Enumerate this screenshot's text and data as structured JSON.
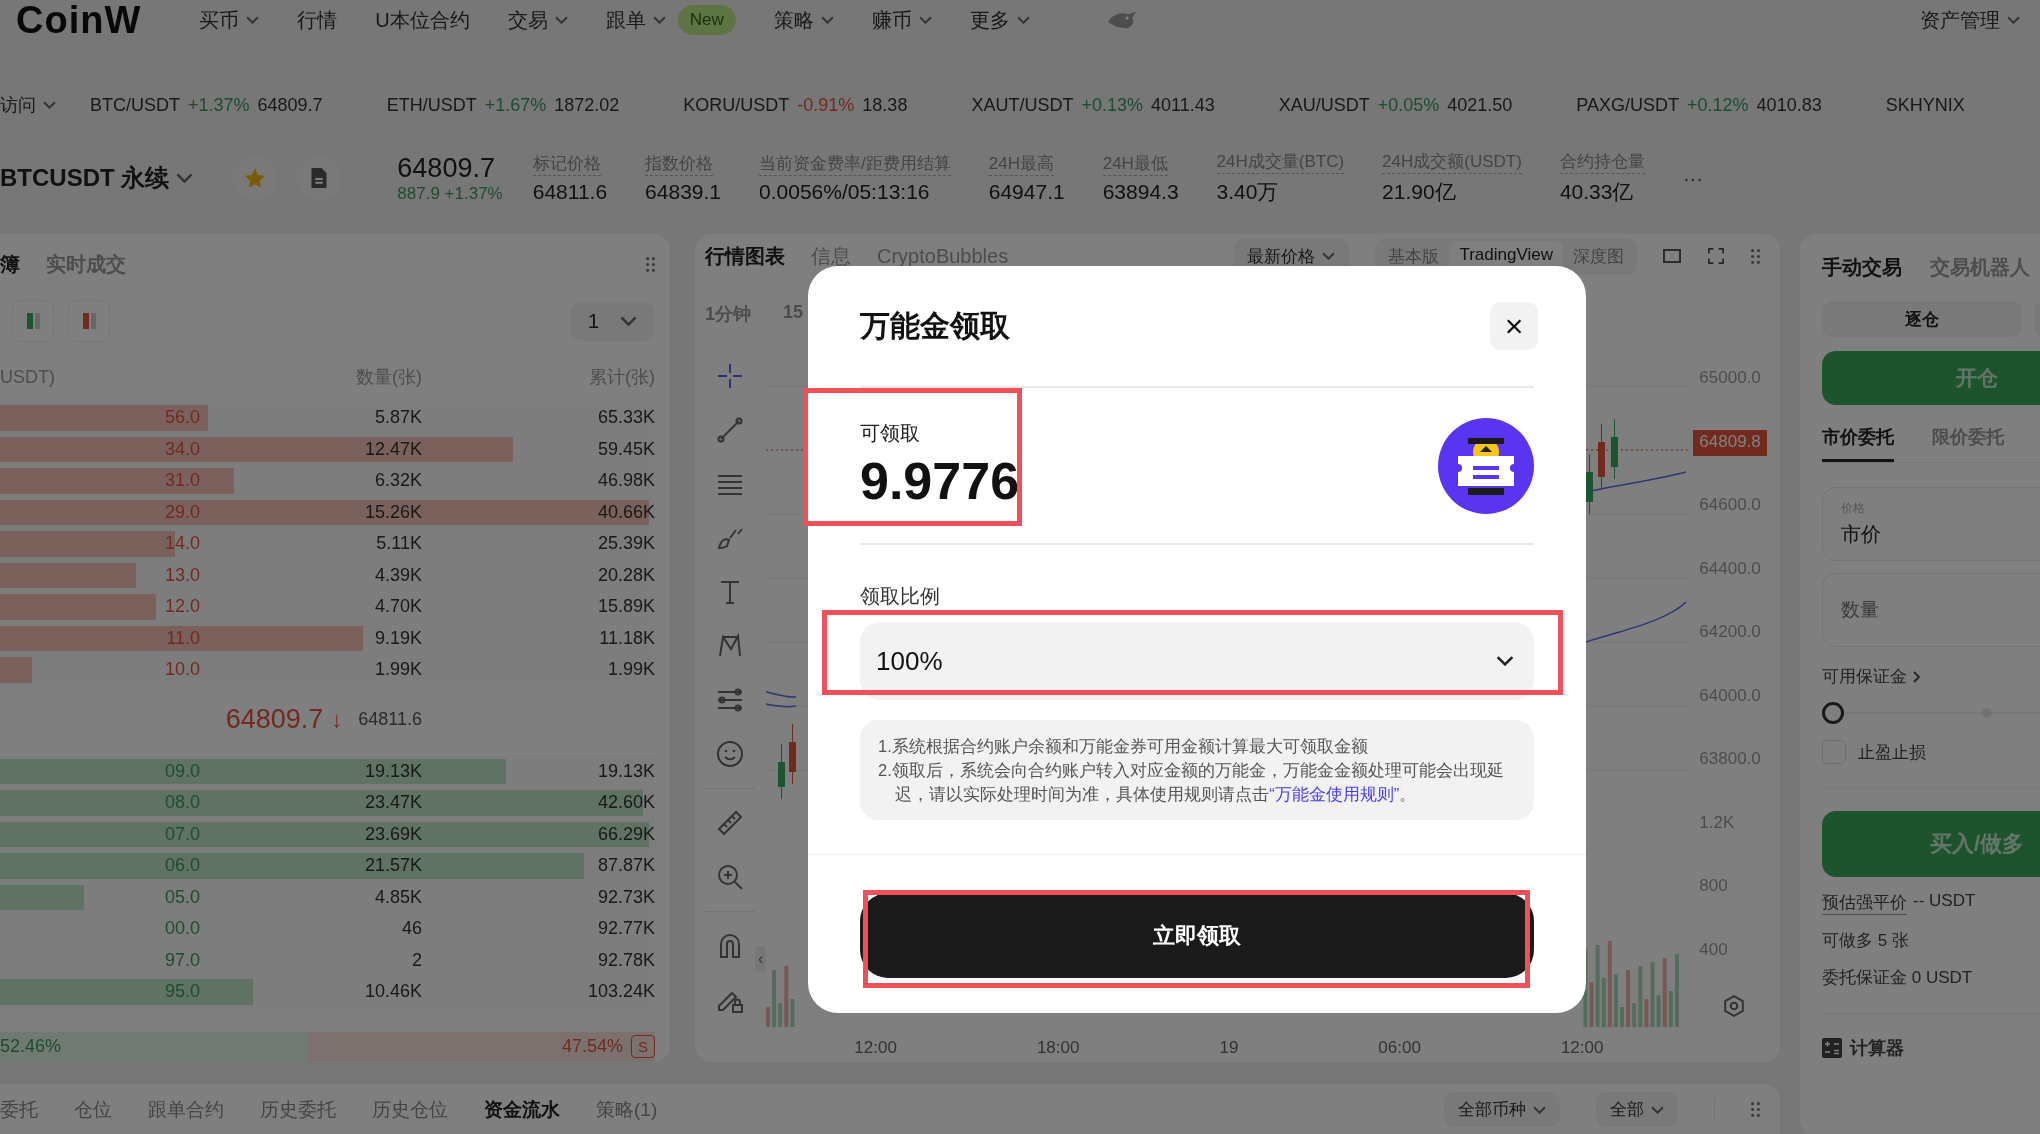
{
  "nav": {
    "logo": "CoinW",
    "items": [
      {
        "label": "买币",
        "dropdown": true
      },
      {
        "label": "行情",
        "dropdown": false
      },
      {
        "label": "U本位合约",
        "dropdown": false
      },
      {
        "label": "交易",
        "dropdown": true
      },
      {
        "label": "跟单",
        "dropdown": true,
        "badge": "New"
      },
      {
        "label": "策略",
        "dropdown": true
      },
      {
        "label": "赚币",
        "dropdown": true
      },
      {
        "label": "更多",
        "dropdown": true
      }
    ],
    "account": {
      "label": "资产管理",
      "dropdown": true
    }
  },
  "ticker": {
    "lead": "访问",
    "pairs": [
      {
        "symbol": "BTC/USDT",
        "change": "+1.37%",
        "rising": true,
        "price": "64809.7"
      },
      {
        "symbol": "ETH/USDT",
        "change": "+1.67%",
        "rising": true,
        "price": "1872.02"
      },
      {
        "symbol": "KORU/USDT",
        "change": "-0.91%",
        "rising": false,
        "price": "18.38"
      },
      {
        "symbol": "XAUT/USDT",
        "change": "+0.13%",
        "rising": true,
        "price": "4011.43"
      },
      {
        "symbol": "XAU/USDT",
        "change": "+0.05%",
        "rising": true,
        "price": "4021.50"
      },
      {
        "symbol": "PAXG/USDT",
        "change": "+0.12%",
        "rising": true,
        "price": "4010.83"
      },
      {
        "symbol": "SKHYNIX"
      }
    ]
  },
  "market": {
    "symbol": "BTCUSDT 永续",
    "favorited": true,
    "price": "64809.7",
    "change": "887.9 +1.37%",
    "stats": [
      {
        "label": "标记价格",
        "value": "64811.6"
      },
      {
        "label": "指数价格",
        "value": "64839.1"
      },
      {
        "label": "当前资金费率/距费用结算",
        "value": "0.0056%/05:13:16"
      },
      {
        "label": "24H最高",
        "value": "64947.1"
      },
      {
        "label": "24H最低",
        "value": "63894.3"
      },
      {
        "label": "24H成交量(BTC)",
        "value": "3.40万"
      },
      {
        "label": "24H成交额(USDT)",
        "value": "21.90亿"
      },
      {
        "label": "合约持仓量",
        "value": "40.33亿"
      }
    ],
    "more": "···"
  },
  "order_book": {
    "tabs": [
      {
        "label": "簿",
        "selected": true
      },
      {
        "label": "实时成交",
        "selected": false
      }
    ],
    "precision": "1",
    "columns": [
      "USDT)",
      "数量(张)",
      "累计(张)"
    ],
    "asks": [
      {
        "price": "56.0",
        "qty": "5.87K",
        "total": "65.33K",
        "level": 0.32
      },
      {
        "price": "34.0",
        "qty": "12.47K",
        "total": "59.45K",
        "level": 0.79
      },
      {
        "price": "31.0",
        "qty": "6.32K",
        "total": "46.98K",
        "level": 0.36
      },
      {
        "price": "29.0",
        "qty": "15.26K",
        "total": "40.66K",
        "level": 1.0
      },
      {
        "price": "14.0",
        "qty": "5.11K",
        "total": "25.39K",
        "level": 0.27
      },
      {
        "price": "13.0",
        "qty": "4.39K",
        "total": "20.28K",
        "level": 0.21
      },
      {
        "price": "12.0",
        "qty": "4.70K",
        "total": "15.89K",
        "level": 0.24
      },
      {
        "price": "11.0",
        "qty": "9.19K",
        "total": "11.18K",
        "level": 0.56
      },
      {
        "price": "10.0",
        "qty": "1.99K",
        "total": "1.99K",
        "level": 0.05
      }
    ],
    "last_price": "64809.7",
    "last_arrow": "↓",
    "mark_price": "64811.6",
    "bids": [
      {
        "price": "09.0",
        "qty": "19.13K",
        "total": "19.13K",
        "level": 0.78
      },
      {
        "price": "08.0",
        "qty": "23.47K",
        "total": "42.60K",
        "level": 0.99
      },
      {
        "price": "07.0",
        "qty": "23.69K",
        "total": "66.29K",
        "level": 1.0
      },
      {
        "price": "06.0",
        "qty": "21.57K",
        "total": "87.87K",
        "level": 0.9
      },
      {
        "price": "05.0",
        "qty": "4.85K",
        "total": "92.73K",
        "level": 0.13
      },
      {
        "price": "00.0",
        "qty": "46",
        "total": "92.77K"
      },
      {
        "price": "97.0",
        "qty": "2",
        "total": "92.78K"
      },
      {
        "price": "95.0",
        "qty": "10.46K",
        "total": "103.24K",
        "level": 0.39
      }
    ],
    "ratio": {
      "buy": "52.46%",
      "sell": "47.54%",
      "level": 0.47,
      "badge": "S"
    }
  },
  "chart": {
    "tabs": [
      {
        "label": "行情图表",
        "selected": true
      },
      {
        "label": "信息",
        "selected": false
      },
      {
        "label": "CryptoBubbles",
        "selected": false
      }
    ],
    "price_type": "最新价格",
    "views": [
      {
        "label": "基本版",
        "selected": false
      },
      {
        "label": "TradingView",
        "selected": true
      },
      {
        "label": "深度图",
        "selected": false
      }
    ],
    "intervals": [
      "1分钟",
      "15"
    ],
    "collapse": "‹",
    "axis": [
      {
        "label": "65000.0",
        "kind": "tick"
      },
      {
        "label": "64809.8",
        "kind": "last"
      },
      {
        "label": "64600.0",
        "kind": "tick"
      },
      {
        "label": "64400.0",
        "kind": "tick"
      },
      {
        "label": "64200.0",
        "kind": "tick"
      },
      {
        "label": "64000.0",
        "kind": "tick"
      },
      {
        "label": "63800.0",
        "kind": "tick"
      },
      {
        "label": "1.2K",
        "kind": "tick"
      },
      {
        "label": "800",
        "kind": "tick"
      },
      {
        "label": "400",
        "kind": "tick"
      }
    ],
    "times": [
      "12:00",
      "18:00",
      "19",
      "06:00",
      "12:00"
    ]
  },
  "trade_panel": {
    "tabs": [
      {
        "label": "手动交易",
        "selected": true
      },
      {
        "label": "交易机器人",
        "selected": false
      }
    ],
    "margin_mode": "逐仓",
    "action": "开仓",
    "order_tabs": [
      {
        "label": "市价委托",
        "selected": true
      },
      {
        "label": "限价委托",
        "selected": false
      }
    ],
    "price_field": {
      "label": "价格",
      "value": "市价"
    },
    "qty_field": {
      "placeholder": "数量"
    },
    "available": "可用保证金",
    "slider": {
      "level": 0
    },
    "tpsl": {
      "label": "止盈止损",
      "checked": false
    },
    "submit": "买入/做多",
    "liq_label": "预估强平价",
    "liq_value": "-- USDT",
    "info": [
      "可做多 5 张",
      "委托保证金 0 USDT"
    ],
    "calculator": "计算器"
  },
  "bottom": {
    "tabs": [
      {
        "label": "委托",
        "selected": false
      },
      {
        "label": "仓位",
        "selected": false
      },
      {
        "label": "跟单合约",
        "selected": false
      },
      {
        "label": "历史委托",
        "selected": false
      },
      {
        "label": "历史仓位",
        "selected": false
      },
      {
        "label": "资金流水",
        "selected": true
      },
      {
        "label": "策略(1)",
        "selected": false
      }
    ],
    "filters": [
      "全部币种",
      "全部"
    ]
  },
  "dialog": {
    "title": "万能金领取",
    "close": "×",
    "amount": {
      "label": "可领取",
      "value": "9.9776",
      "highlighted": true
    },
    "ratio": {
      "label": "领取比例",
      "value": "100%",
      "highlighted": true
    },
    "notes": [
      {
        "text": "1.系统根据合约账户余额和万能金券可用金额计算最大可领取金额"
      },
      {
        "text": "2.领取后，系统会向合约账户转入对应金额的万能金，万能金金额处理可能会出现延迟，请以实际处理时间为准，具体使用规则请点击",
        "link": "“万能金使用规则”",
        "tail": "。"
      }
    ],
    "button": {
      "label": "立即领取",
      "highlighted": true
    }
  }
}
